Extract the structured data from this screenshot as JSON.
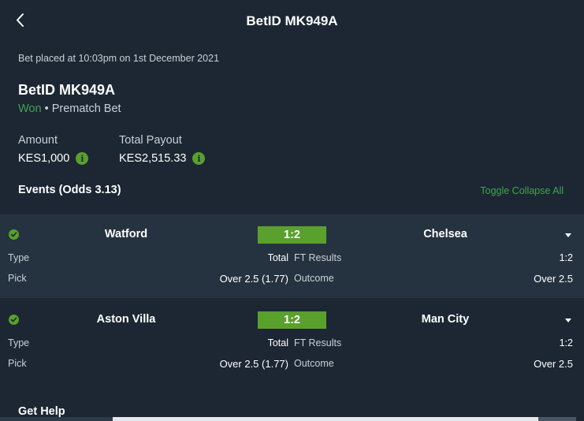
{
  "header": {
    "title": "BetID MK949A",
    "back_icon": "chevron-left-icon"
  },
  "bet": {
    "placed_text": "Bet placed at 10:03pm on 1st December 2021",
    "id": "BetID MK949A",
    "status": "Won",
    "separator": "•",
    "type": "Prematch Bet",
    "amount_label": "Amount",
    "amount_value": "KES1,000",
    "payout_label": "Total Payout",
    "payout_value": "KES2,515.33",
    "info_icon_glyph": "i"
  },
  "events_section": {
    "title": "Events (Odds 3.13)",
    "toggle_label": "Toggle Collapse All"
  },
  "events": [
    {
      "home": "Watford",
      "score": "1:2",
      "away": "Chelsea",
      "type_label": "Type",
      "type_value": "Total",
      "market_label": "FT Results",
      "market_value": "1:2",
      "pick_label": "Pick",
      "pick_value": "Over 2.5 (1.77)",
      "outcome_label": "Outcome",
      "outcome_value": "Over 2.5"
    },
    {
      "home": "Aston Villa",
      "score": "1:2",
      "away": "Man City",
      "type_label": "Type",
      "type_value": "Total",
      "market_label": "FT Results",
      "market_value": "1:2",
      "pick_label": "Pick",
      "pick_value": "Over 2.5 (1.77)",
      "outcome_label": "Outcome",
      "outcome_value": "Over 2.5"
    }
  ],
  "footer": {
    "help_label": "Get Help"
  },
  "colors": {
    "background": "#1c2733",
    "row_alt": "#253340",
    "accent_green": "#5aa02c",
    "won_green": "#3fa34d"
  }
}
